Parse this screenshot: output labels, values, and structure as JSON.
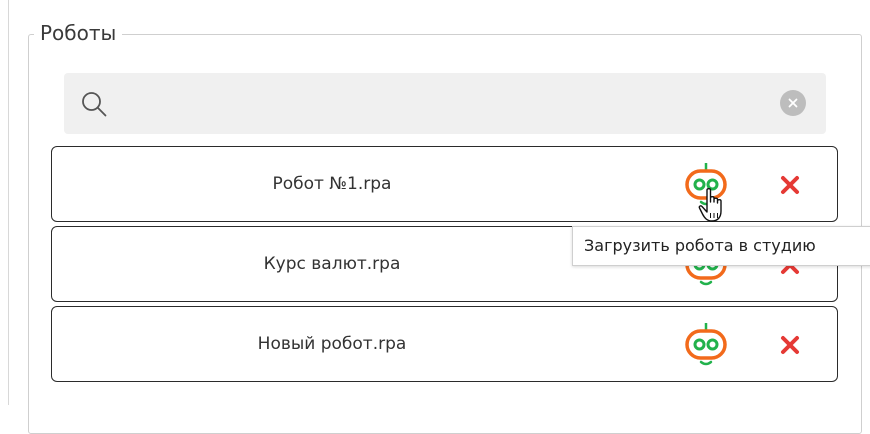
{
  "panel": {
    "title": "Роботы"
  },
  "search": {
    "value": "",
    "placeholder": ""
  },
  "robots": [
    {
      "name": "Робот №1.rpa"
    },
    {
      "name": "Курс валют.rpa"
    },
    {
      "name": "Новый робот.rpa"
    }
  ],
  "tooltip": {
    "text": "Загрузить робота в студию"
  },
  "icons": {
    "search": "search-icon",
    "clear": "clear-icon",
    "load": "robot-head-icon",
    "delete": "x-icon",
    "cursor": "hand-pointer-icon"
  },
  "colors": {
    "robot_orange": "#f26a1b",
    "robot_green": "#22b24c",
    "delete_red": "#e53935",
    "search_bg": "#f0f0f0",
    "clear_bg": "#bdbdbd"
  }
}
